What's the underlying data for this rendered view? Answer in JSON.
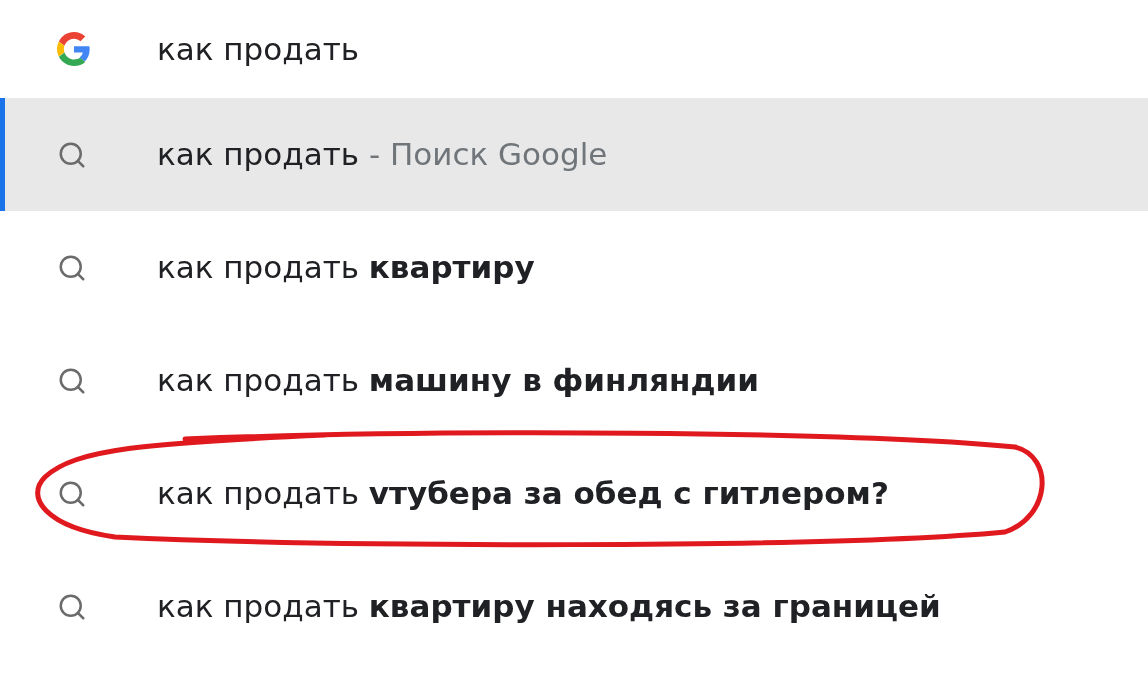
{
  "rows": [
    {
      "kind": "query",
      "text": "как продать",
      "selected": false,
      "circled": false
    },
    {
      "kind": "suggestion",
      "text": "как продать",
      "suffix": "- Поиск Google",
      "selected": true,
      "circled": false
    },
    {
      "kind": "suggestion",
      "text": "как продать **квартиру**",
      "selected": false,
      "circled": false
    },
    {
      "kind": "suggestion",
      "text": "как продать **машину в финляндии**",
      "selected": false,
      "circled": false
    },
    {
      "kind": "suggestion",
      "text": "как продать **vтубера за обед с гитлером?**",
      "selected": false,
      "circled": true
    },
    {
      "kind": "suggestion",
      "text": "как продать **квартиру находясь за границей**",
      "selected": false,
      "circled": false
    }
  ]
}
